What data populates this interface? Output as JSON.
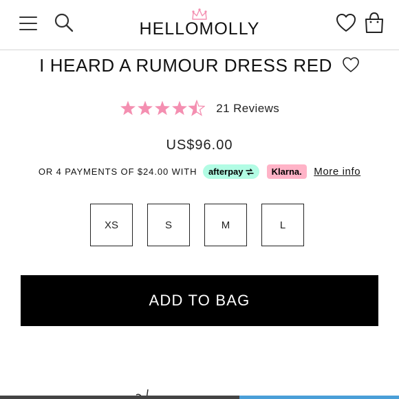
{
  "header": {
    "logo_text": "HELLOMOLLY",
    "menu_icon": "hamburger-menu-icon",
    "search_icon": "search-icon",
    "wishlist_icon": "heart-icon",
    "bag_icon": "shopping-bag-icon",
    "crown_icon": "crown-icon"
  },
  "product": {
    "title": "I HEARD A RUMOUR DRESS RED",
    "rating": 4.5,
    "rating_max": 5,
    "reviews_label": "21 Reviews",
    "price": "US$96.00",
    "star_color": "#f48fb1"
  },
  "payments": {
    "text": "OR 4 PAYMENTS OF $24.00 WITH",
    "afterpay_label": "afterpay",
    "klarna_label": "Klarna.",
    "more_info_label": "More info",
    "afterpay_color": "#b2fce4",
    "klarna_color": "#ffb3c7"
  },
  "sizes": [
    "XS",
    "S",
    "M",
    "L"
  ],
  "cta": {
    "add_to_bag_label": "ADD TO BAG"
  }
}
